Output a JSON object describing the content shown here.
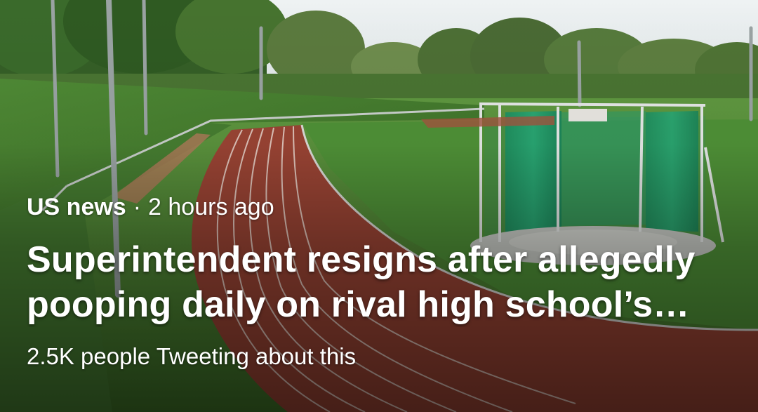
{
  "article": {
    "source": "US news",
    "separator": "·",
    "time": "2 hours ago",
    "headline": "Superintendent resigns after allegedly pooping daily on rival high school’s track",
    "social": "2.5K people Tweeting about this"
  },
  "image": {
    "subject": "athletics-stadium-photo"
  },
  "colors": {
    "text": "#ffffff",
    "track": "#9a4434",
    "grass": "#4f8a35",
    "sky": "#e6ebee",
    "cage_net": "#1f9a6c"
  }
}
